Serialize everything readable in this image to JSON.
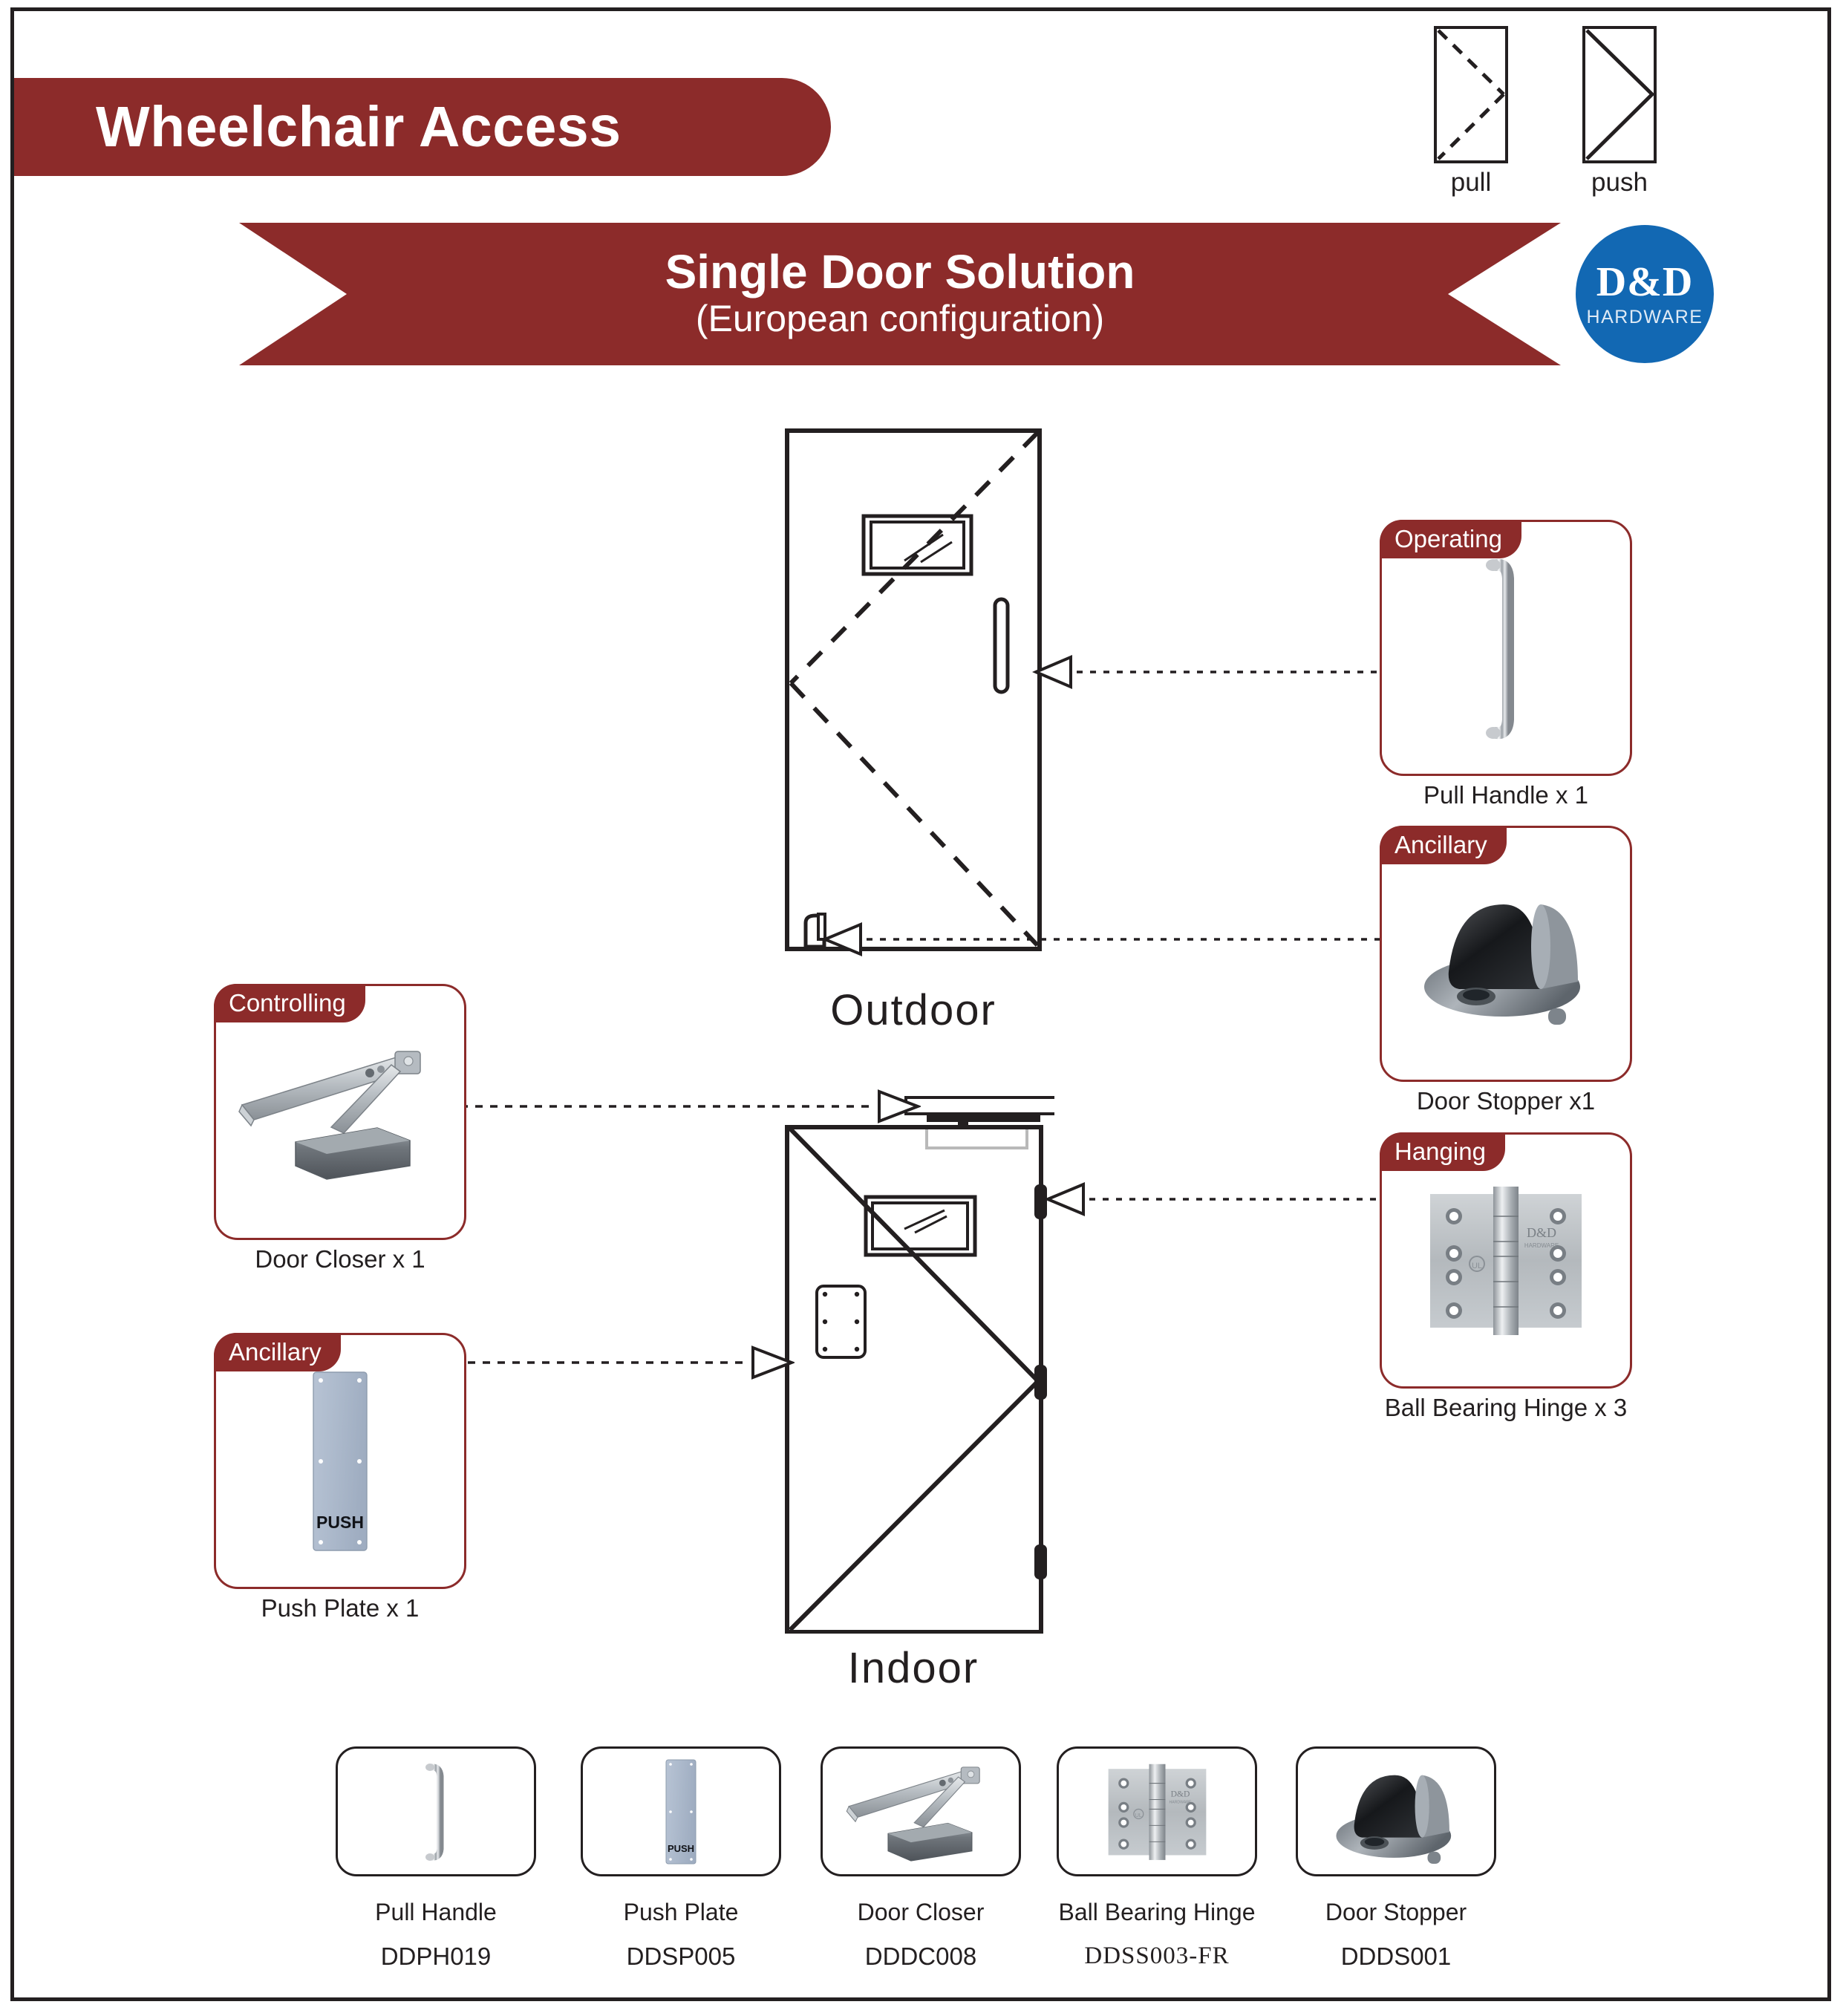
{
  "header": {
    "title": "Wheelchair Access"
  },
  "legend": {
    "items": [
      {
        "label": "pull",
        "icon": "door-swing-dashed-icon"
      },
      {
        "label": "push",
        "icon": "door-swing-solid-icon"
      }
    ]
  },
  "banner": {
    "title": "Single Door Solution",
    "subtitle": "(European configuration)",
    "color": "#8c2b2a"
  },
  "logo": {
    "main": "D&D",
    "sub": "HARDWARE",
    "color": "#1268b3"
  },
  "doors": {
    "outdoor_caption": "Outdoor",
    "indoor_caption": "Indoor"
  },
  "callouts": [
    {
      "tag": "Operating",
      "label": "Pull Handle x 1",
      "icon": "pull-handle-icon",
      "side": "right"
    },
    {
      "tag": "Ancillary",
      "label": "Door Stopper x1",
      "icon": "door-stopper-icon",
      "side": "right"
    },
    {
      "tag": "Hanging",
      "label": "Ball Bearing Hinge x 3",
      "icon": "ball-bearing-hinge-icon",
      "side": "right"
    },
    {
      "tag": "Controlling",
      "label": "Door Closer x 1",
      "icon": "door-closer-icon",
      "side": "left"
    },
    {
      "tag": "Ancillary",
      "label": "Push Plate x 1",
      "icon": "push-plate-icon",
      "side": "left"
    }
  ],
  "push_plate_text": "PUSH",
  "hinge_brand": {
    "main": "D&D",
    "sub": "HARDWARE"
  },
  "product_strip": [
    {
      "name": "Pull Handle",
      "code": "DDPH019",
      "icon": "pull-handle-icon"
    },
    {
      "name": "Push Plate",
      "code": "DDSP005",
      "icon": "push-plate-icon"
    },
    {
      "name": "Door Closer",
      "code": "DDDC008",
      "icon": "door-closer-icon"
    },
    {
      "name": "Ball Bearing Hinge",
      "code": "DDSS003-FR",
      "icon": "ball-bearing-hinge-icon"
    },
    {
      "name": "Door Stopper",
      "code": "DDDS001",
      "icon": "door-stopper-icon"
    }
  ]
}
